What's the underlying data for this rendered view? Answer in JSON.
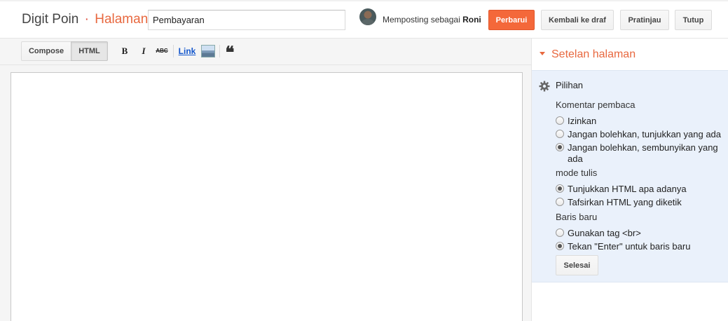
{
  "header": {
    "blog_name": "Digit Poin",
    "separator": "·",
    "section": "Halaman",
    "title_value": "Pembayaran",
    "posting_as_prefix": "Memposting sebagai",
    "user_name": "Roni",
    "buttons": {
      "update": "Perbarui",
      "revert": "Kembali ke draf",
      "preview": "Pratinjau",
      "close": "Tutup"
    }
  },
  "toolbar": {
    "compose": "Compose",
    "html": "HTML",
    "active_mode": "HTML",
    "bold": "B",
    "italic": "I",
    "strike": "ABC",
    "link": "Link",
    "image_icon": "image-icon",
    "quote": "❝"
  },
  "editor": {
    "content": ""
  },
  "sidebar": {
    "title": "Setelan halaman",
    "options": {
      "title": "Pilihan",
      "reader_comments": {
        "label": "Komentar pembaca",
        "options": [
          "Izinkan",
          "Jangan bolehkan, tunjukkan yang ada",
          "Jangan bolehkan, sembunyikan yang ada"
        ],
        "selected": "Jangan bolehkan, sembunyikan yang ada"
      },
      "compose_mode": {
        "label": "mode tulis",
        "options": [
          "Tunjukkan HTML apa adanya",
          "Tafsirkan HTML yang diketik"
        ],
        "selected": "Tunjukkan HTML apa adanya"
      },
      "line_breaks": {
        "label": "Baris baru",
        "options": [
          "Gunakan tag <br>",
          "Tekan \"Enter\" untuk baris baru"
        ],
        "selected": "Tekan \"Enter\" untuk baris baru"
      },
      "done": "Selesai"
    }
  },
  "colors": {
    "accent": "#e8683f",
    "primary_button": "#f4683a",
    "options_panel": "#eaf1fb",
    "link": "#1155cc"
  }
}
